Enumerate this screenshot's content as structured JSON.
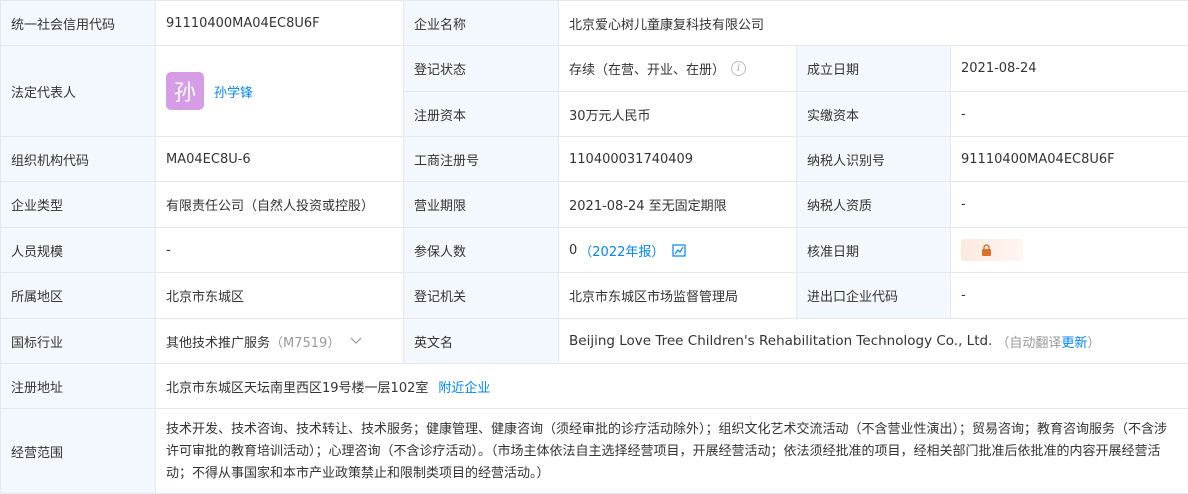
{
  "labels": {
    "credit_code": "统一社会信用代码",
    "company_name": "企业名称",
    "legal_rep": "法定代表人",
    "reg_status": "登记状态",
    "founded": "成立日期",
    "reg_capital": "注册资本",
    "paid_capital": "实缴资本",
    "org_code": "组织机构代码",
    "biz_reg_no": "工商注册号",
    "taxpayer_id": "纳税人识别号",
    "company_type": "企业类型",
    "biz_term": "营业期限",
    "taxpayer_qual": "纳税人资质",
    "staff_size": "人员规模",
    "insured": "参保人数",
    "approval_date": "核准日期",
    "region": "所属地区",
    "reg_authority": "登记机关",
    "import_export_code": "进出口企业代码",
    "industry": "国标行业",
    "english_name": "英文名",
    "reg_address": "注册地址",
    "biz_scope": "经营范围"
  },
  "values": {
    "credit_code": "91110400MA04EC8U6F",
    "company_name": "北京爱心树儿童康复科技有限公司",
    "legal_rep_avatar": "孙",
    "legal_rep_name": "孙学锋",
    "reg_status": "存续（在营、开业、在册）",
    "founded": "2021-08-24",
    "reg_capital": "30万元人民币",
    "paid_capital": "-",
    "org_code": "MA04EC8U-6",
    "biz_reg_no": "110400031740409",
    "taxpayer_id": "91110400MA04EC8U6F",
    "company_type": "有限责任公司（自然人投资或控股）",
    "biz_term": "2021-08-24 至无固定期限",
    "taxpayer_qual": "-",
    "staff_size": "-",
    "insured_count": "0",
    "insured_year": "（2022年报）",
    "region": "北京市东城区",
    "reg_authority": "北京市东城区市场监督管理局",
    "import_export_code": "-",
    "industry_name": "其他技术推广服务",
    "industry_code": "（M7519）",
    "english_name": "Beijing Love Tree Children's Rehabilitation Technology Co., Ltd.",
    "auto_translate": "（自动翻译",
    "update_link": "更新",
    "close_paren": "）",
    "reg_address": "北京市东城区天坛南里西区19号楼一层102室",
    "nearby_link": "附近企业",
    "biz_scope": "技术开发、技术咨询、技术转让、技术服务；健康管理、健康咨询（须经审批的诊疗活动除外）；组织文化艺术交流活动（不含营业性演出）；贸易咨询；教育咨询服务（不含涉许可审批的教育培训活动）；心理咨询（不含诊疗活动）。（市场主体依法自主选择经营项目，开展经营活动；依法须经批准的项目，经相关部门批准后依批准的内容开展经营活动；不得从事国家和本市产业政策禁止和限制类项目的经营活动。）"
  },
  "icons": {
    "info": "info-circle-icon",
    "chart": "trend-chart-icon",
    "lock": "lock-icon",
    "chevron": "chevron-down-icon"
  },
  "colors": {
    "label_bg": "#f2f8fd",
    "border": "#e4e7ed",
    "link": "#0084ff",
    "avatar_bg": "#d79ce6",
    "lock": "#d9722a"
  }
}
